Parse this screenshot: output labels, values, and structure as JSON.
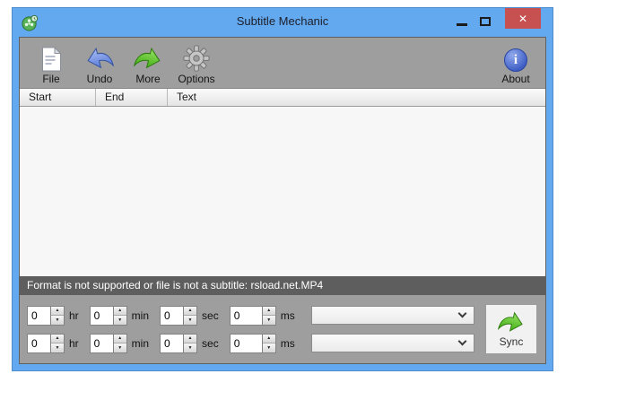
{
  "window": {
    "title": "Subtitle Mechanic"
  },
  "icons": {
    "close": "✕",
    "about_letter": "i",
    "spinner_up": "▲",
    "spinner_down": "▼"
  },
  "toolbar": {
    "file": "File",
    "undo": "Undo",
    "more": "More",
    "options": "Options",
    "about": "About"
  },
  "table": {
    "columns": {
      "start": "Start",
      "end": "End",
      "text": "Text"
    },
    "rows": []
  },
  "status": {
    "message": "Format is not supported or file is not a subtitle: rsload.net.MP4"
  },
  "sync_panel": {
    "labels": {
      "hr": "hr",
      "min": "min",
      "sec": "sec",
      "ms": "ms"
    },
    "row1": {
      "hr": "0",
      "min": "0",
      "sec": "0",
      "ms": "0",
      "combo_value": ""
    },
    "row2": {
      "hr": "0",
      "min": "0",
      "sec": "0",
      "ms": "0",
      "combo_value": ""
    },
    "sync_label": "Sync"
  },
  "colors": {
    "titlebar_blue": "#63a9ef",
    "close_red": "#c75050",
    "toolbar_gray": "#9e9e9e",
    "status_gray": "#5e5e5e",
    "arrow_green": "#4caf1d",
    "arrow_blue": "#6b8fe0"
  }
}
